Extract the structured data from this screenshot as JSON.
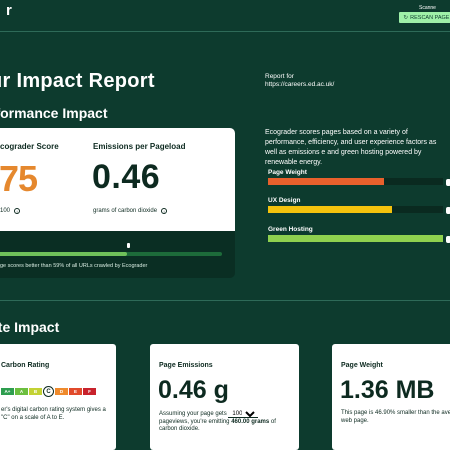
{
  "header": {
    "logo_fragment": "r",
    "scanner_label": "Scanne",
    "rescan_label": "RESCAN PAGE",
    "rescan_icon": "refresh-icon"
  },
  "report": {
    "title": "ur Impact Report",
    "report_for_label": "Report for",
    "report_for_url": "https://careers.ed.ac.uk/"
  },
  "performance": {
    "section_title": "rformance Impact",
    "ecograder_heading": "cograder Score",
    "ecograder_value": "75",
    "ecograder_sub": "100",
    "emissions_heading": "Emissions per Pageload",
    "emissions_value": "0.46",
    "emissions_sub": "grams of carbon dioxide",
    "score_percent": 59,
    "score_note": "ge scores better than 59% of all URLs crawled by Ecograder"
  },
  "description": "Ecograder scores pages based on a variety of performance, efficiency, and user experience factors as well as emissions e and green hosting powered by renewable energy.",
  "metrics": [
    {
      "label": "Page Weight",
      "fill_percent": 66,
      "color": "#e8602c"
    },
    {
      "label": "UX Design",
      "fill_percent": 71,
      "color": "#f4c20d"
    },
    {
      "label": "Green Hosting",
      "fill_percent": 100,
      "color": "#8fd14f"
    }
  ],
  "climate": {
    "section_title": "ate Impact",
    "carbon_rating_title": "Carbon Rating",
    "ratings": [
      {
        "label": "A+",
        "color": "#2e9e4f"
      },
      {
        "label": "A",
        "color": "#6cbf3f"
      },
      {
        "label": "B",
        "color": "#c3d234"
      },
      {
        "label": "C",
        "color": "#f2c230"
      },
      {
        "label": "D",
        "color": "#ef8a2c"
      },
      {
        "label": "E",
        "color": "#e14a2b"
      },
      {
        "label": "F",
        "color": "#c8222c"
      }
    ],
    "selected_rating": "C",
    "carbon_rating_text": "er's digital carbon rating system gives a \"C\" on a scale of A to E.",
    "page_emissions_title": "Page Emissions",
    "page_emissions_value": "0.46 g",
    "assuming_prefix": "Assuming your page gets",
    "pageviews_value": "1000",
    "pageviews_suffix": "pageviews, you're emitting",
    "emitting_value": "460.00 grams",
    "emitting_suffix": "of carbon dioxide.",
    "page_weight_title": "Page Weight",
    "page_weight_value": "1.36 MB",
    "page_weight_text": "This page is 46.90% smaller than the ave web page."
  }
}
